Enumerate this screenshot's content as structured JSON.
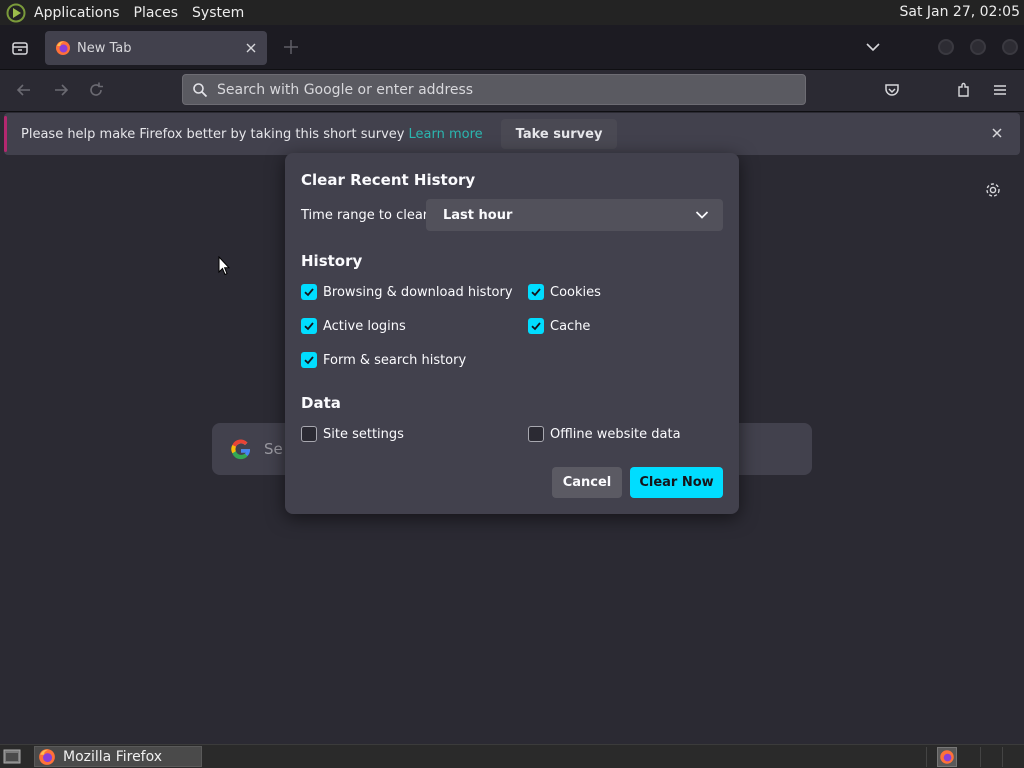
{
  "top_panel": {
    "menus": [
      "Applications",
      "Places",
      "System"
    ],
    "clock": "Sat Jan 27, 02:05"
  },
  "tabs": [
    {
      "title": "New Tab"
    }
  ],
  "toolbar": {
    "url_placeholder": "Search with Google or enter address"
  },
  "notification": {
    "message": "Please help make Firefox better by taking this short survey",
    "link": "Learn more",
    "button": "Take survey"
  },
  "newtab": {
    "search_placeholder": "Se"
  },
  "dialog": {
    "title": "Clear Recent History",
    "time_range_label": "Time range to clear:",
    "time_range_value": "Last hour",
    "history_heading": "History",
    "history_items": [
      {
        "label": "Browsing & download history",
        "checked": true
      },
      {
        "label": "Cookies",
        "checked": true
      },
      {
        "label": "Active logins",
        "checked": true
      },
      {
        "label": "Cache",
        "checked": true
      },
      {
        "label": "Form & search history",
        "checked": true
      }
    ],
    "data_heading": "Data",
    "data_items": [
      {
        "label": "Site settings",
        "checked": false
      },
      {
        "label": "Offline website data",
        "checked": false
      }
    ],
    "cancel": "Cancel",
    "clear_now": "Clear Now"
  },
  "taskbar": {
    "window_title": "Mozilla Firefox"
  },
  "colors": {
    "accent": "#00ddff",
    "dialog_bg": "#42414d",
    "page_bg": "#2b2a33",
    "tabstrip_bg": "#1c1b22",
    "link": "#2bb6b0"
  },
  "icons": {
    "distro": "distro-logo-icon",
    "list_tabs": "list-all-tabs-icon",
    "favicon": "firefox-icon",
    "close": "close-icon",
    "new_tab": "plus-icon",
    "overflow": "chevron-down-icon",
    "back": "back-arrow-icon",
    "forward": "forward-arrow-icon",
    "reload": "reload-icon",
    "search": "search-icon",
    "pocket": "pocket-icon",
    "extensions": "extensions-icon",
    "menu": "hamburger-menu-icon",
    "gear": "gear-icon",
    "google": "google-logo-icon",
    "checkmark": "checkmark-icon"
  }
}
